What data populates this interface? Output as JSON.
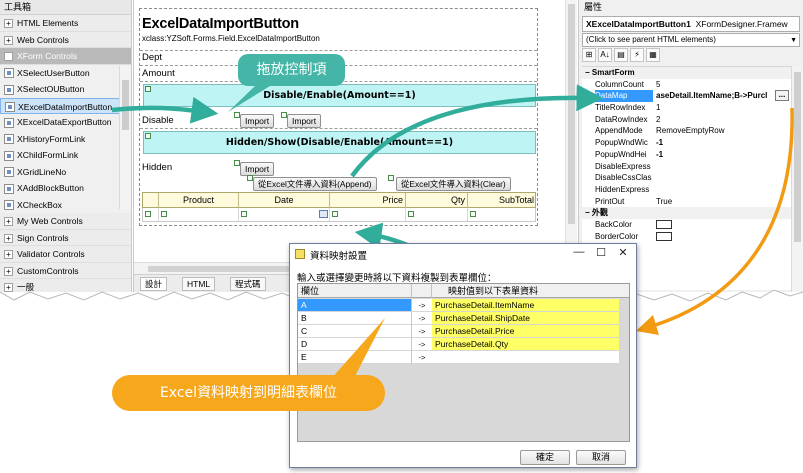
{
  "toolbox": {
    "title": "工具箱",
    "groups_top": [
      {
        "label": "HTML Elements",
        "expander": "+"
      },
      {
        "label": "Web Controls",
        "expander": "+"
      },
      {
        "label": "XForm Controls",
        "expander": "-"
      }
    ],
    "items": [
      "XSelectUserButton",
      "XSelectOUButton",
      "XExcelDataImportButton",
      "XExcelDataExportButton",
      "XHistoryFormLink",
      "XChildFormLink",
      "XGridLineNo",
      "XAddBlockButton",
      "XCheckBox"
    ],
    "groups_bottom": [
      {
        "label": "My Web Controls",
        "expander": "+"
      },
      {
        "label": "Sign Controls",
        "expander": "+"
      },
      {
        "label": "Validator Controls",
        "expander": "+"
      },
      {
        "label": "CustomControls",
        "expander": "+"
      },
      {
        "label": "一般",
        "expander": "+"
      }
    ]
  },
  "designer": {
    "form_title": "ExcelDataImportButton",
    "form_class": "xclass:YZSoft.Forms.Field.ExcelDataImportButton",
    "labels": {
      "dept": "Dept",
      "amount": "Amount",
      "disable": "Disable",
      "hidden": "Hidden"
    },
    "bar1": "Disable/Enable(Amount==1)",
    "bar2": "Hidden/Show(Disable/Enable(Amount==1)",
    "import_label": "Import",
    "append_btn": "從Excel文件導入資料(Append)",
    "clear_btn": "從Excel文件導入資料(Clear)",
    "grid_columns": [
      "Product",
      "Date",
      "Price",
      "Qty",
      "SubTotal"
    ],
    "tabs": [
      "設計",
      "HTML",
      "程式碼"
    ]
  },
  "properties": {
    "title": "屬性",
    "object_name": "XExcelDataImportButton1",
    "object_type": "XFormDesigner.Framew",
    "parent_link": "(Click to see parent HTML elements)",
    "tools": [
      "⊞",
      "A↓",
      "▤",
      "⚡",
      "▦"
    ],
    "rows": [
      {
        "kind": "cat",
        "name": "SmartForm"
      },
      {
        "name": "ColumnCount",
        "value": "5"
      },
      {
        "name": "DataMap",
        "value": "aseDetail.ItemName;B->Purcl",
        "selected": true,
        "ellipsis": "..."
      },
      {
        "name": "TitleRowIndex",
        "value": "1"
      },
      {
        "name": "DataRowIndex",
        "value": "2"
      },
      {
        "name": "AppendMode",
        "value": "RemoveEmptyRow"
      },
      {
        "name": "PopupWndWic",
        "value": "-1"
      },
      {
        "name": "PopupWndHei",
        "value": "-1"
      },
      {
        "name": "DisableExpress",
        "value": ""
      },
      {
        "name": "DisableCssClas",
        "value": ""
      },
      {
        "name": "HiddenExpress",
        "value": ""
      },
      {
        "name": "PrintOut",
        "value": "True"
      },
      {
        "kind": "cat",
        "name": "外觀"
      },
      {
        "name": "BackColor",
        "value": "",
        "color": "#ffffff"
      },
      {
        "name": "BorderColor",
        "value": "",
        "color": "#ffffff"
      }
    ]
  },
  "dialog": {
    "title": "資料映射設置",
    "instruction": "輸入或選擇變更時將以下資料複製到表單欄位：",
    "col_field": "欄位",
    "col_target": "映射值到以下表單資料",
    "rows": [
      {
        "col": "A",
        "arrow": "->",
        "target": "PurchaseDetail.ItemName"
      },
      {
        "col": "B",
        "arrow": "->",
        "target": "PurchaseDetail.ShipDate"
      },
      {
        "col": "C",
        "arrow": "->",
        "target": "PurchaseDetail.Price"
      },
      {
        "col": "D",
        "arrow": "->",
        "target": "PurchaseDetail.Qty"
      },
      {
        "col": "E",
        "arrow": "->",
        "target": ""
      }
    ],
    "ok": "確定",
    "cancel": "取消",
    "controls": {
      "min": "—",
      "max": "☐",
      "close": "✕"
    }
  },
  "callouts": {
    "drag": "拖放控制項",
    "excel": "Excel資料映射到明細表欄位"
  },
  "colors": {
    "teal_callout": "#44b5a7",
    "orange_callout": "#f7a71c",
    "cyan_bar": "#bff4f4",
    "yellow_mapping": "#ffff66",
    "selection_blue": "#3399ff"
  }
}
